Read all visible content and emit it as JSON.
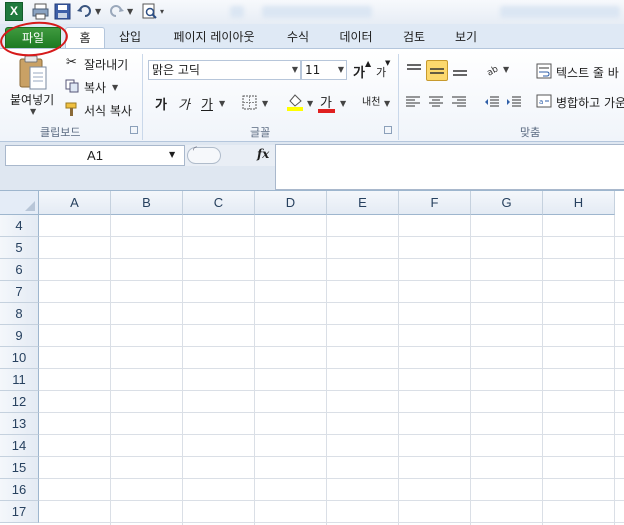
{
  "title_bar": {
    "app_icon_letter": "X"
  },
  "tabs": [
    {
      "label": "파일"
    },
    {
      "label": "홈"
    },
    {
      "label": "삽입"
    },
    {
      "label": "페이지 레이아웃"
    },
    {
      "label": "수식"
    },
    {
      "label": "데이터"
    },
    {
      "label": "검토"
    },
    {
      "label": "보기"
    }
  ],
  "clipboard": {
    "paste_label": "붙여넣기",
    "cut_label": "잘라내기",
    "copy_label": "복사",
    "format_painter_label": "서식 복사",
    "group_label": "클립보드"
  },
  "font": {
    "font_name": "맑은 고딕",
    "font_size": "11",
    "bold_label": "가",
    "italic_label": "가",
    "underline_label": "가",
    "font_color_label": "가",
    "grow_label": "가",
    "shrink_label": "가",
    "phonetic_label": "내천",
    "group_label": "글꼴"
  },
  "alignment": {
    "wrap_text_label": "텍스트 줄 바",
    "merge_label": "병합하고 가운",
    "group_label": "맞춤"
  },
  "formula_bar": {
    "name_box_value": "A1",
    "fx_label": "fx",
    "formula_value": ""
  },
  "columns": [
    "A",
    "B",
    "C",
    "D",
    "E",
    "F",
    "G",
    "H"
  ],
  "rows": [
    "4",
    "5",
    "6",
    "7",
    "8",
    "9",
    "10",
    "11",
    "12",
    "13",
    "14",
    "15",
    "16",
    "17"
  ],
  "colors": {
    "file_tab": "#1d7a22",
    "annotation_circle": "#d61a1a",
    "ribbon_bg": "#f0f4fa",
    "header_bg": "#e4ebf4"
  }
}
